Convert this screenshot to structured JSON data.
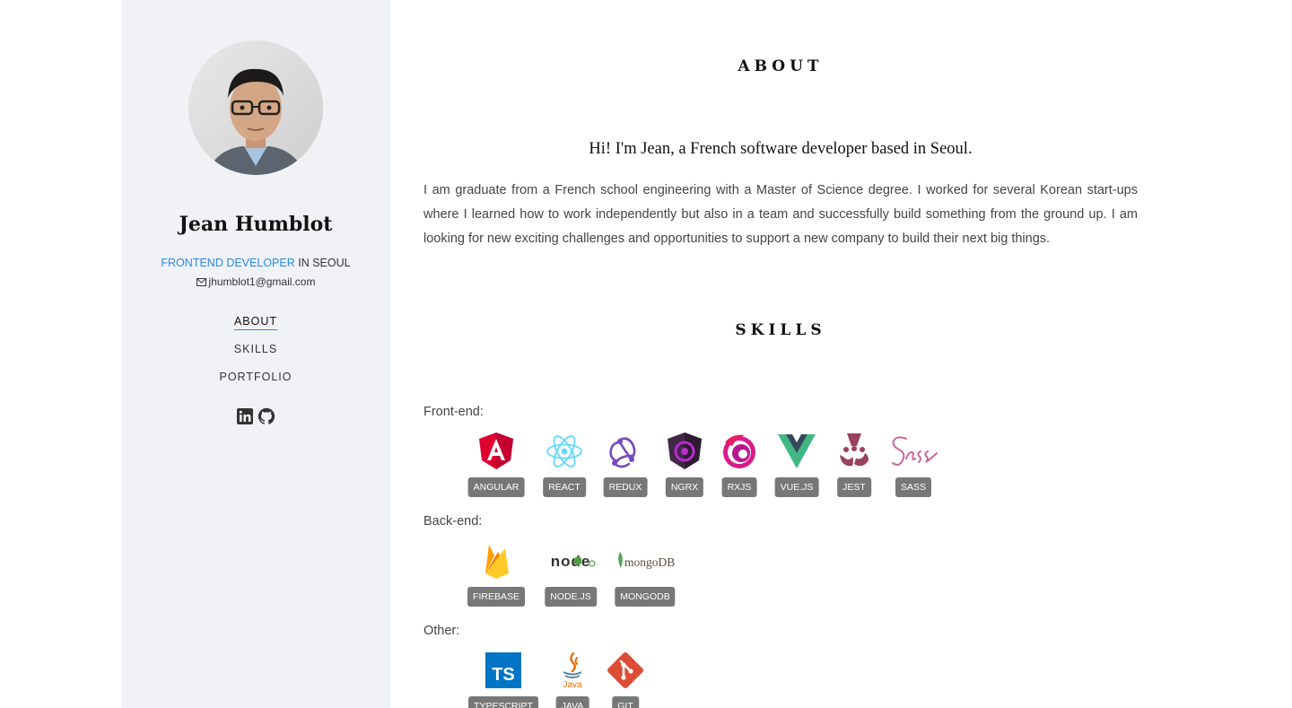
{
  "profile": {
    "name": "Jean Humblot",
    "role_accent": "FRONTEND DEVELOPER",
    "role_rest": " IN SEOUL",
    "email": "jhumblot1@gmail.com"
  },
  "nav": {
    "items": [
      {
        "label": "ABOUT",
        "active": true
      },
      {
        "label": "SKILLS",
        "active": false
      },
      {
        "label": "PORTFOLIO",
        "active": false
      }
    ]
  },
  "social": [
    "linkedin-icon",
    "github-icon"
  ],
  "about": {
    "title": "ABOUT",
    "greeting": "Hi! I'm Jean, a French software developer based in Seoul.",
    "bio": "I am graduate from a French school engineering with a Master of Science degree. I worked for several Korean start-ups where I learned how to work independently but also in a team and successfully build something from the ground up. I am looking for new exciting challenges and opportunities to support a new company to build their next big things."
  },
  "skills": {
    "title": "SKILLS",
    "frontend_label": "Front-end:",
    "backend_label": "Back-end:",
    "other_label": "Other:",
    "frontend": [
      {
        "name": "ANGULAR",
        "icon": "angular-icon"
      },
      {
        "name": "REACT",
        "icon": "react-icon"
      },
      {
        "name": "REDUX",
        "icon": "redux-icon"
      },
      {
        "name": "NGRX",
        "icon": "ngrx-icon"
      },
      {
        "name": "RXJS",
        "icon": "rxjs-icon"
      },
      {
        "name": "VUE.JS",
        "icon": "vue-icon"
      },
      {
        "name": "JEST",
        "icon": "jest-icon"
      },
      {
        "name": "SASS",
        "icon": "sass-icon"
      }
    ],
    "backend": [
      {
        "name": "FIREBASE",
        "icon": "firebase-icon"
      },
      {
        "name": "NODE.JS",
        "icon": "nodejs-icon",
        "logo_text": "node"
      },
      {
        "name": "MONGODB",
        "icon": "mongodb-icon",
        "logo_text": "mongoDB"
      }
    ],
    "other": [
      {
        "name": "TYPESCRIPT",
        "icon": "typescript-icon",
        "logo_text": "TS"
      },
      {
        "name": "JAVA",
        "icon": "java-icon",
        "logo_text": "Java"
      },
      {
        "name": "GIT",
        "icon": "git-icon"
      }
    ]
  },
  "colors": {
    "accent": "#2a8ae0",
    "sidebar_bg": "#f1f2f6",
    "badge_bg": "#777777"
  }
}
